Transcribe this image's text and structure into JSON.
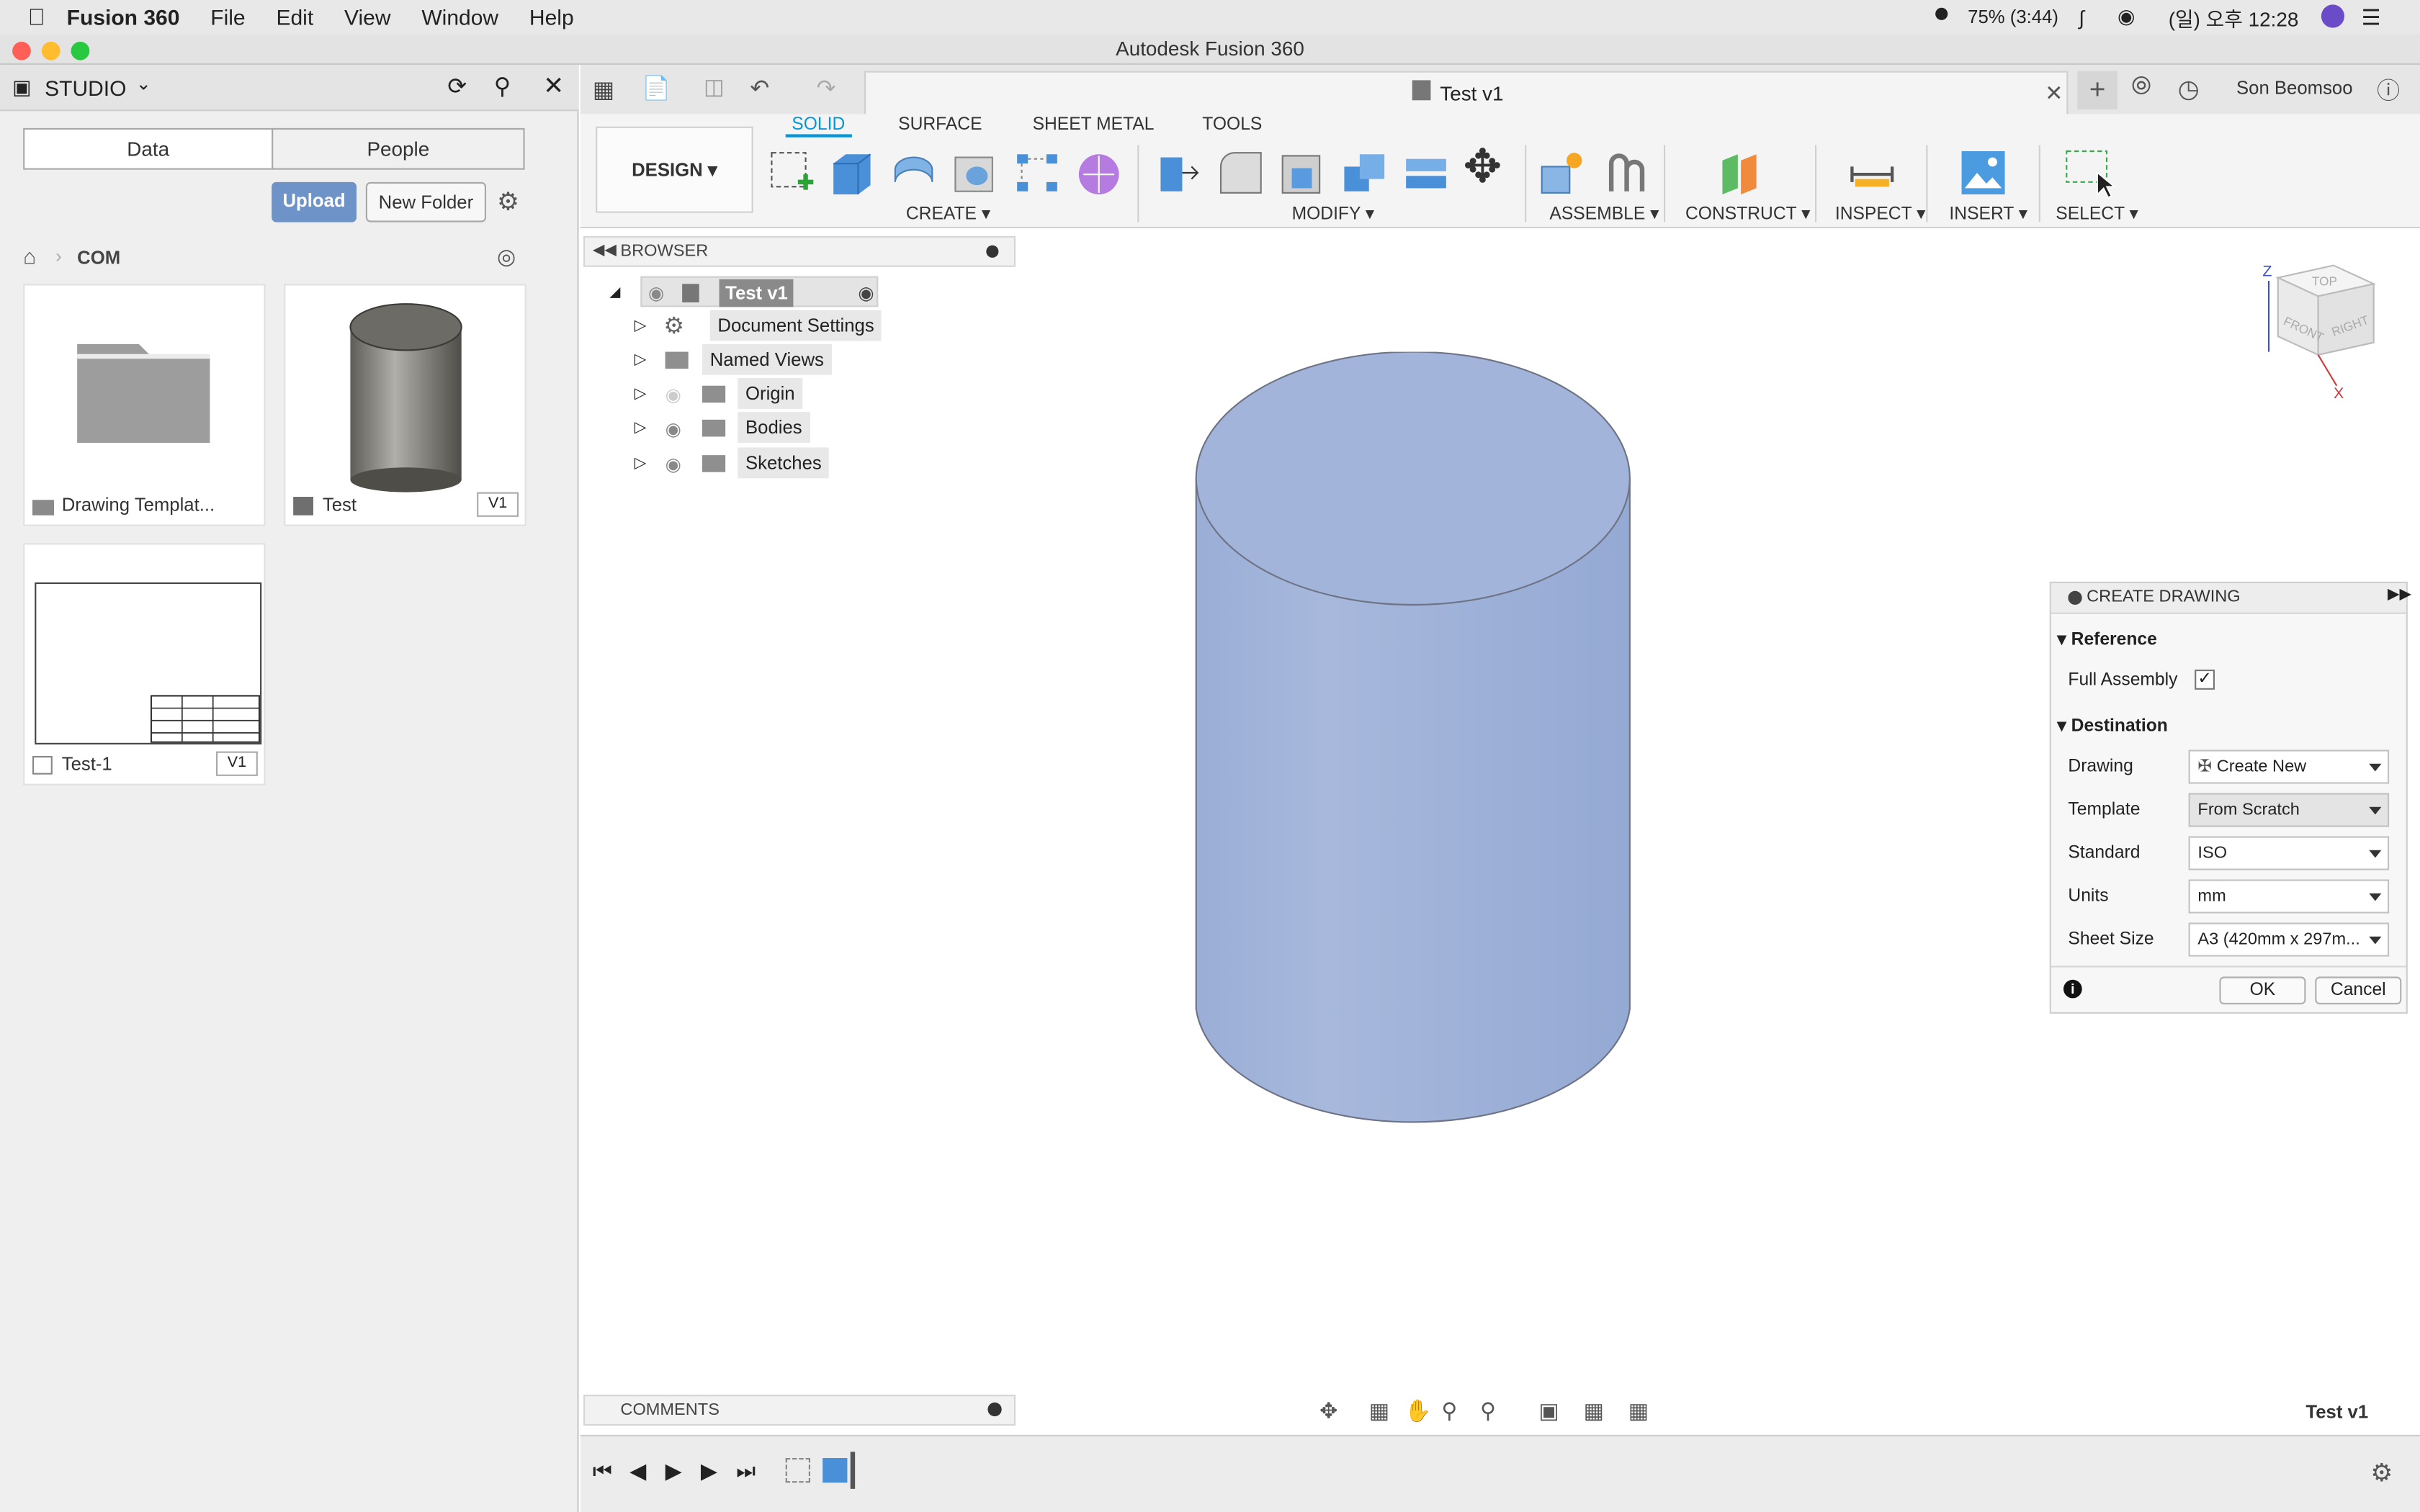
{
  "mac_menu": {
    "app_name": "Fusion 360",
    "items": [
      "File",
      "Edit",
      "View",
      "Window",
      "Help"
    ],
    "battery": "75% (3:44)",
    "clock": "(일) 오후 12:28"
  },
  "window_title": "Autodesk Fusion 360",
  "studio": {
    "name": "STUDIO",
    "tabs": [
      "Data",
      "People"
    ],
    "upload": "Upload",
    "new_folder": "New Folder",
    "breadcrumb": "COM",
    "items": [
      {
        "name": "Drawing Templat..."
      },
      {
        "name": "Test",
        "version": "V1"
      },
      {
        "name": "Test-1",
        "version": "V1"
      }
    ]
  },
  "doc_tab": {
    "title": "Test v1",
    "user": "Son Beomsoo"
  },
  "ribbon": {
    "workspace": "DESIGN",
    "tabs": [
      "SOLID",
      "SURFACE",
      "SHEET METAL",
      "TOOLS"
    ],
    "groups": [
      "CREATE",
      "MODIFY",
      "ASSEMBLE",
      "CONSTRUCT",
      "INSPECT",
      "INSERT",
      "SELECT"
    ]
  },
  "browser": {
    "title": "BROWSER",
    "root": "Test v1",
    "nodes": [
      "Document Settings",
      "Named Views",
      "Origin",
      "Bodies",
      "Sketches"
    ]
  },
  "comments": "COMMENTS",
  "viewcube": {
    "top": "TOP",
    "front": "FRONT",
    "right": "RIGHT",
    "z": "Z",
    "x": "X"
  },
  "status_doc": "Test v1",
  "dialog": {
    "title": "CREATE DRAWING",
    "reference": "Reference",
    "full_assembly": "Full Assembly",
    "destination": "Destination",
    "fields": [
      {
        "label": "Drawing",
        "value": "Create New"
      },
      {
        "label": "Template",
        "value": "From Scratch"
      },
      {
        "label": "Standard",
        "value": "ISO"
      },
      {
        "label": "Units",
        "value": "mm"
      },
      {
        "label": "Sheet Size",
        "value": "A3 (420mm x 297m..."
      }
    ],
    "ok": "OK",
    "cancel": "Cancel"
  },
  "colors": {
    "accent": "#0696d7",
    "body": "#a3b5d9",
    "upload": "#6d93c8"
  }
}
